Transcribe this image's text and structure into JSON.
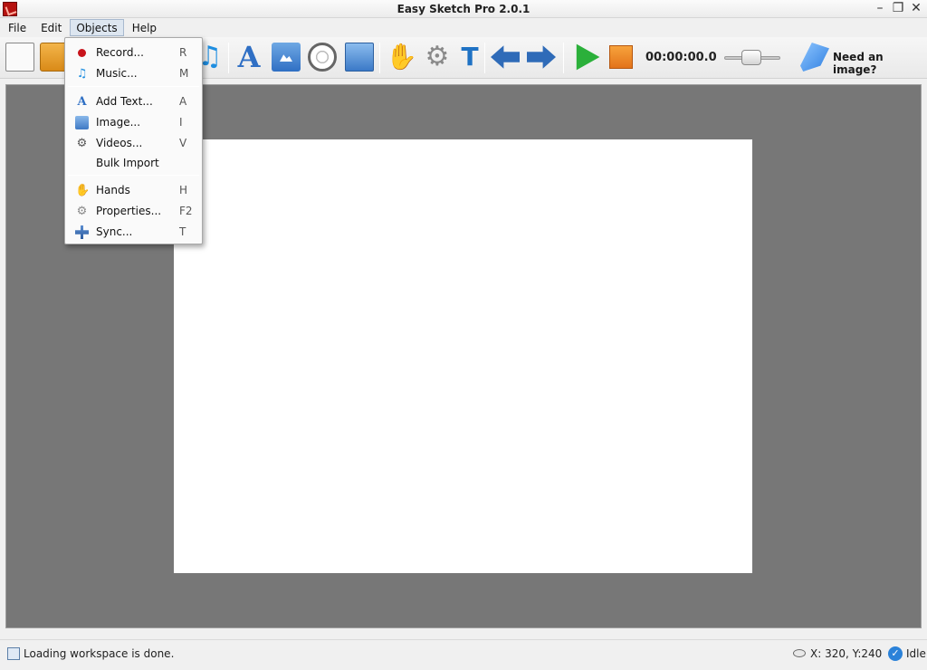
{
  "window": {
    "title": "Easy Sketch Pro 2.0.1",
    "minimize": "–",
    "restore": "❐",
    "close": "✕"
  },
  "menubar": {
    "items": [
      {
        "label": "File"
      },
      {
        "label": "Edit"
      },
      {
        "label": "Objects",
        "open": true
      },
      {
        "label": "Help"
      }
    ]
  },
  "toolbar": {
    "timer": "00:00:00.0",
    "need_image_label": "Need an image?",
    "music_glyph": "♫",
    "text_glyph": "A",
    "hand_glyph": "✋",
    "gear_glyph": "⚙",
    "t_glyph": "T"
  },
  "objects_menu": {
    "items": [
      {
        "label": "Record...",
        "shortcut": "R",
        "icon": "record-icon"
      },
      {
        "label": "Music...",
        "shortcut": "M",
        "icon": "music-icon"
      },
      {
        "label": "Add Text...",
        "shortcut": "A",
        "icon": "text-icon"
      },
      {
        "label": "Image...",
        "shortcut": "I",
        "icon": "image-icon"
      },
      {
        "label": "Videos...",
        "shortcut": "V",
        "icon": "video-icon"
      },
      {
        "label": "Bulk Import",
        "shortcut": "",
        "icon": ""
      },
      {
        "label": "Hands",
        "shortcut": "H",
        "icon": "hand-icon"
      },
      {
        "label": "Properties...",
        "shortcut": "F2",
        "icon": "gear-icon"
      },
      {
        "label": "Sync...",
        "shortcut": "T",
        "icon": "sync-icon"
      }
    ],
    "glyphs": {
      "music": "♫",
      "text": "A",
      "video": "⚙",
      "hand": "✋",
      "gear": "⚙"
    }
  },
  "statusbar": {
    "message": "Loading workspace is done.",
    "coords": "X: 320, Y:240",
    "state": "Idle",
    "state_glyph": "✓"
  },
  "colors": {
    "workspace_bg": "#777777",
    "canvas_bg": "#ffffff",
    "play_green": "#2bb03a",
    "stop_orange": "#e3731a",
    "accent_blue": "#2f6fc4"
  }
}
